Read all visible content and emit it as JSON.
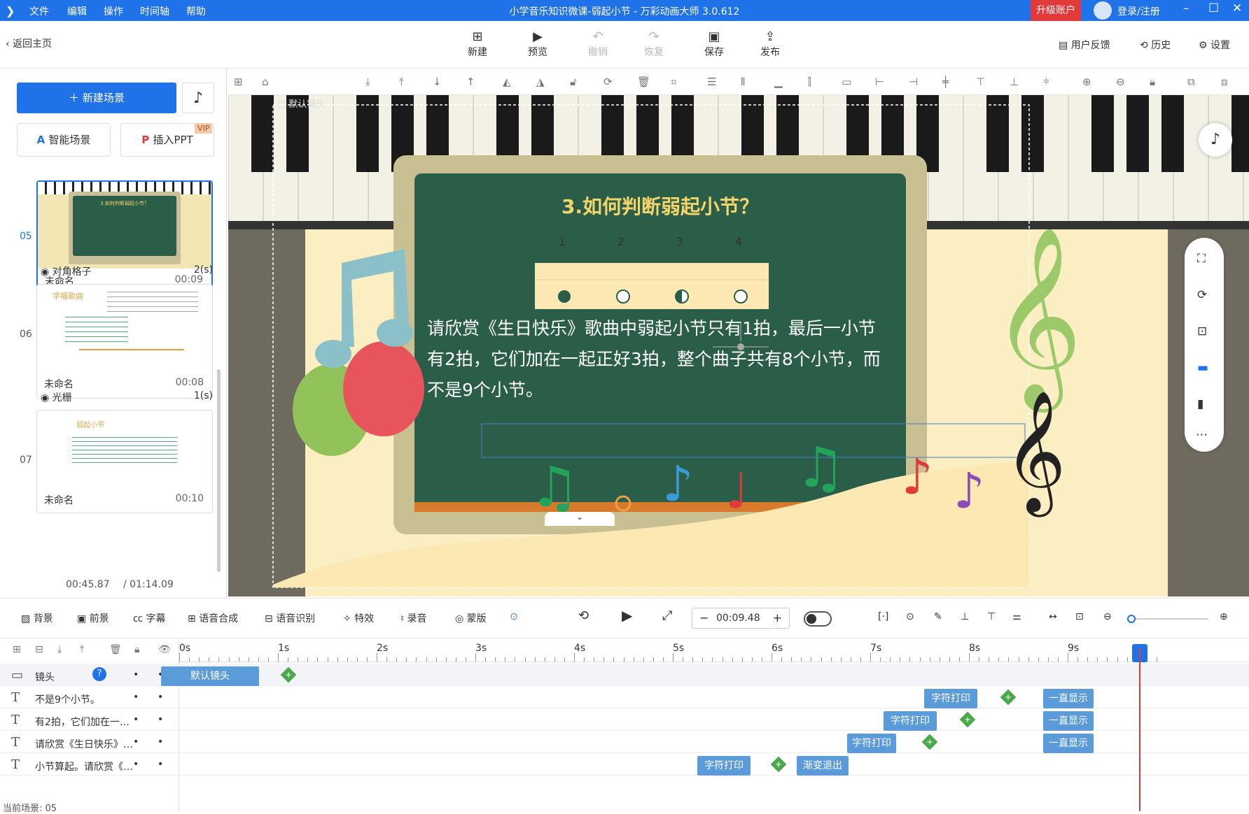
{
  "app": {
    "title": "小学音乐知识微课-弱起小节 - 万彩动画大师 3.0.612",
    "menus": [
      "文件",
      "编辑",
      "操作",
      "时间轴",
      "帮助"
    ],
    "upgrade": "升级账户",
    "login": "登录/注册"
  },
  "toolbar": {
    "back": "返回主页",
    "buttons": [
      {
        "label": "新建",
        "icon": "plus-square-icon",
        "enabled": true
      },
      {
        "label": "预览",
        "icon": "play-icon",
        "enabled": true
      },
      {
        "label": "撤销",
        "icon": "undo-icon",
        "enabled": false
      },
      {
        "label": "恢复",
        "icon": "redo-icon",
        "enabled": false
      },
      {
        "label": "保存",
        "icon": "save-icon",
        "enabled": true
      },
      {
        "label": "发布",
        "icon": "publish-icon",
        "enabled": true
      }
    ],
    "feedback": "用户反馈",
    "history": "历史",
    "settings": "设置"
  },
  "left": {
    "new_scene": "新建场景",
    "smart_scene": "智能场景",
    "insert_ppt": "插入PPT",
    "vip": "VIP",
    "scenes": [
      {
        "num": "05",
        "name": "未命名",
        "time": "00:09",
        "active": true
      },
      {
        "num": "06",
        "name": "未命名",
        "time": "00:08",
        "active": false
      },
      {
        "num": "07",
        "name": "未命名",
        "time": "00:10",
        "active": false
      }
    ],
    "transitions": [
      {
        "name": "对角格子",
        "duration": "2(s)"
      },
      {
        "name": "光栅",
        "duration": "1(s)"
      }
    ],
    "thumb_texts": {
      "s05_title": "3.如何判断弱起小节？",
      "s06_title": "学唱歌曲",
      "s07_title": "弱起小节"
    },
    "current_time": "00:45.87",
    "total_time": "/ 01:14.09"
  },
  "canvas": {
    "camera_label": "默认镜头",
    "heading": "3.如何判断弱起小节？",
    "beats": [
      "1",
      "2",
      "3",
      "4"
    ],
    "body_lines": [
      "请欣赏《生日快乐》歌曲中弱起小节只有1拍，最后一小节",
      "有2拍，它们加在一起正好3拍，整个曲子共有8个小节，而",
      "不是9个小节。"
    ]
  },
  "bottombar": {
    "items": [
      "背景",
      "前景",
      "字幕",
      "语音合成",
      "语音识别",
      "特效",
      "录音",
      "蒙版"
    ],
    "time": "00:09.48"
  },
  "timeline": {
    "ticks": [
      "0s",
      "1s",
      "2s",
      "3s",
      "4s",
      "5s",
      "6s",
      "7s",
      "8s",
      "9s"
    ],
    "rows": [
      {
        "label": "镜头",
        "blocks": [
          "默认镜头"
        ]
      },
      {
        "label": "不是9个小节。",
        "blocks": [
          "字符打印",
          "一直显示"
        ]
      },
      {
        "label": "有2拍，它们加在一…",
        "blocks": [
          "字符打印",
          "一直显示"
        ]
      },
      {
        "label": "请欣赏《生日快乐》…",
        "blocks": [
          "字符打印",
          "一直显示"
        ]
      },
      {
        "label": "小节算起。请欣赏《…",
        "blocks": [
          "字符打印",
          "渐变退出"
        ]
      }
    ],
    "current_scene": "当前场景: 05"
  },
  "colors": {
    "accent": "#1f72e8",
    "upgrade_red": "#e23a3a",
    "board_green": "#2b5e48",
    "block_blue": "#5b9bd9",
    "keyframe_green": "#4aa84a"
  }
}
